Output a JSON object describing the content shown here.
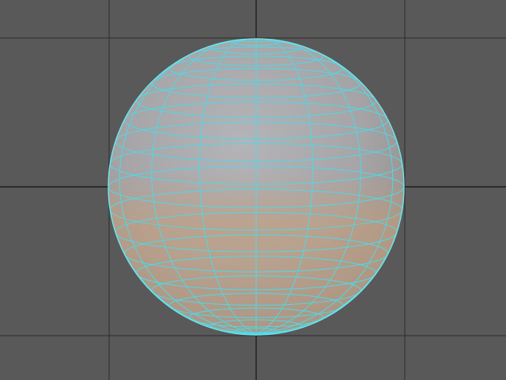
{
  "viewport": {
    "background_color": "#595959",
    "grid_line_color": "#2d2d2d",
    "axis_line_color": "#1f1f1f"
  },
  "sphere": {
    "selected": true,
    "wireframe_color": "#4fd8e6",
    "shading_top_color": "#b4b4b8",
    "shading_mid_color": "#a6a4a6",
    "shading_bottom_color": "#c89e78",
    "outline_color": "#6fe6ef",
    "subdivisions_axis": 16,
    "subdivisions_height": 20
  }
}
